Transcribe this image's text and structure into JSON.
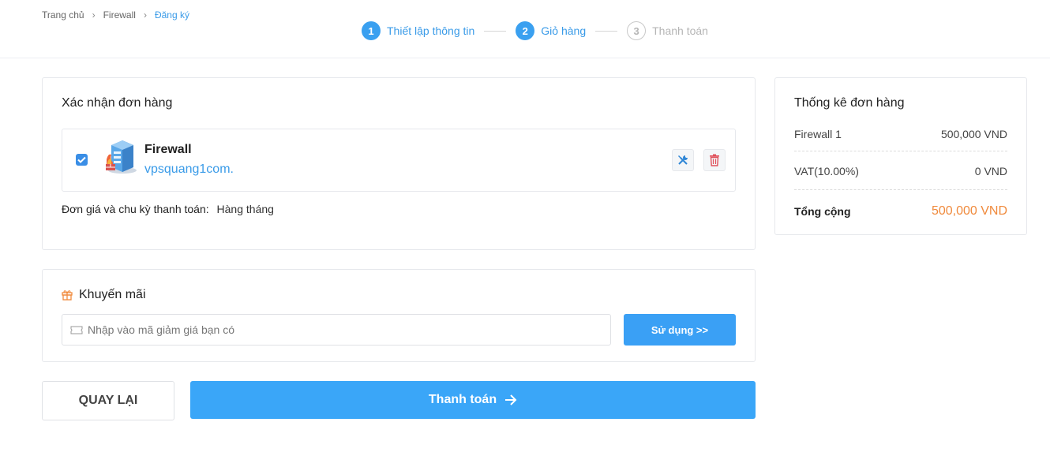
{
  "breadcrumb": {
    "home": "Trang chủ",
    "section": "Firewall",
    "current": "Đăng ký"
  },
  "steps": [
    {
      "num": "1",
      "label": "Thiết lập thông tin",
      "state": "active"
    },
    {
      "num": "2",
      "label": "Giỏ hàng",
      "state": "active"
    },
    {
      "num": "3",
      "label": "Thanh toán",
      "state": "inactive"
    }
  ],
  "order": {
    "title": "Xác nhận đơn hàng",
    "product": {
      "checked": true,
      "name": "Firewall",
      "domain": "vpsquang1com.",
      "icon": "server-firewall-icon"
    },
    "price_label": "Đơn giá và chu kỳ thanh toán:",
    "price_value": "Hàng tháng"
  },
  "promo": {
    "title": "Khuyến mãi",
    "input_placeholder": "Nhập vào mã giảm giá bạn có",
    "apply_label": "Sử dụng >>"
  },
  "actions": {
    "back_label": "QUAY LẠI",
    "pay_label": "Thanh toán"
  },
  "summary": {
    "title": "Thống kê đơn hàng",
    "rows": [
      {
        "label": "Firewall 1",
        "value": "500,000 VND"
      },
      {
        "label": "VAT(10.00%)",
        "value": "0 VND"
      }
    ],
    "total_label": "Tổng cộng",
    "total_value": "500,000 VND"
  },
  "colors": {
    "accent": "#3aa0f5",
    "link": "#3a9be8",
    "total": "#f08a3c",
    "delete": "#e0505a"
  }
}
